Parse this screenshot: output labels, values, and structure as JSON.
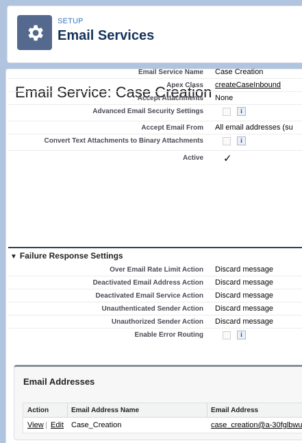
{
  "header": {
    "kicker": "SETUP",
    "title": "Email Services",
    "icon": "gear-icon",
    "accent": "#54698d"
  },
  "page": {
    "title": "Email Service: Case Creation"
  },
  "details": [
    {
      "label": "Email Service Name",
      "value": "Case Creation"
    },
    {
      "label": "Apex Class",
      "value": "createCaseInbound",
      "link": true
    },
    {
      "label": "Accept Attachments",
      "value": "None"
    },
    {
      "label": "Advanced Email Security Settings",
      "checkbox": false,
      "info": "i"
    },
    {
      "label": "Accept Email From",
      "value": "All email addresses (su"
    },
    {
      "label": "Convert Text Attachments to Binary Attachments",
      "checkbox": false,
      "info": "i"
    },
    {
      "label": "Active",
      "checkmark": "✓"
    }
  ],
  "failure_section": {
    "title": "Failure Response Settings",
    "rows": [
      {
        "label": "Over Email Rate Limit Action",
        "value": "Discard message"
      },
      {
        "label": "Deactivated Email Address Action",
        "value": "Discard message"
      },
      {
        "label": "Deactivated Email Service Action",
        "value": "Discard message"
      },
      {
        "label": "Unauthenticated Sender Action",
        "value": "Discard message"
      },
      {
        "label": "Unauthorized Sender Action",
        "value": "Discard message"
      },
      {
        "label": "Enable Error Routing",
        "checkbox": false,
        "info": "i"
      }
    ]
  },
  "email_addresses": {
    "title": "Email Addresses",
    "columns": [
      "Action",
      "Email Address Name",
      "Email Address"
    ],
    "rows": [
      {
        "view": "View",
        "sep": "|",
        "edit": "Edit",
        "name": "Case_Creation",
        "address": "case_creation@a-30fglbwu"
      }
    ]
  }
}
